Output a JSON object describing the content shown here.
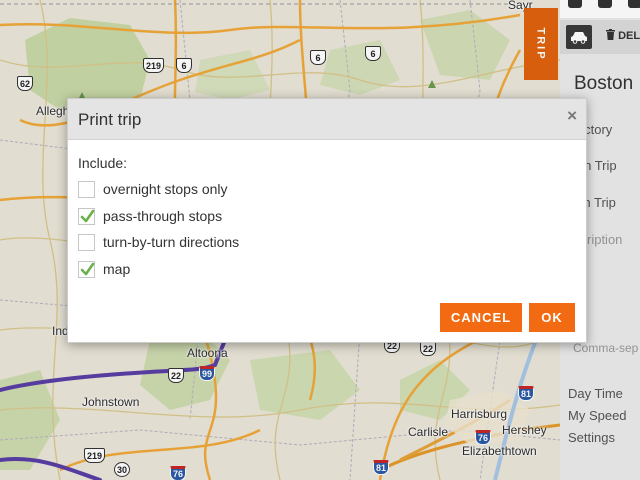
{
  "map": {
    "places": [
      {
        "name": "Allegheny National",
        "id": "allegheny"
      },
      {
        "name": "Altoona",
        "id": "altoona"
      },
      {
        "name": "Johnstown",
        "id": "johnstown"
      },
      {
        "name": "Harrisburg",
        "id": "harrisburg"
      },
      {
        "name": "Carlisle",
        "id": "carlisle"
      },
      {
        "name": "Hershey",
        "id": "hershey"
      },
      {
        "name": "Elizabethtown",
        "id": "elizabethtown"
      },
      {
        "name": "Ind",
        "id": "indiana"
      },
      {
        "name": "Sayr",
        "id": "sayre"
      }
    ],
    "shields": [
      "62",
      "219",
      "6",
      "6",
      "6",
      "22",
      "22",
      "22",
      "99",
      "219",
      "30",
      "76",
      "81",
      "81",
      "76"
    ]
  },
  "trip_tab": {
    "label": "TRIP"
  },
  "panel": {
    "delete_label": "DEL",
    "title": "Boston",
    "fields": [
      "jectory",
      "gin Trip",
      "ish Trip",
      "scription"
    ],
    "tags_hint": "Comma-sep",
    "links": [
      "Day Time",
      "My Speed",
      "Settings"
    ]
  },
  "dialog": {
    "title": "Print trip",
    "close_symbol": "×",
    "include_label": "Include:",
    "options": [
      {
        "label": "overnight stops only",
        "checked": false
      },
      {
        "label": "pass-through stops",
        "checked": true
      },
      {
        "label": "turn-by-turn directions",
        "checked": false
      },
      {
        "label": "map",
        "checked": true
      }
    ],
    "cancel_label": "CANCEL",
    "ok_label": "OK"
  },
  "colors": {
    "accent": "#f26b12",
    "check": "#6ab04c",
    "route": "#5b3fa6",
    "highway": "#f0a93a"
  },
  "icons": [
    "close-icon",
    "check-icon",
    "car-icon",
    "trash-icon",
    "user-icon"
  ]
}
